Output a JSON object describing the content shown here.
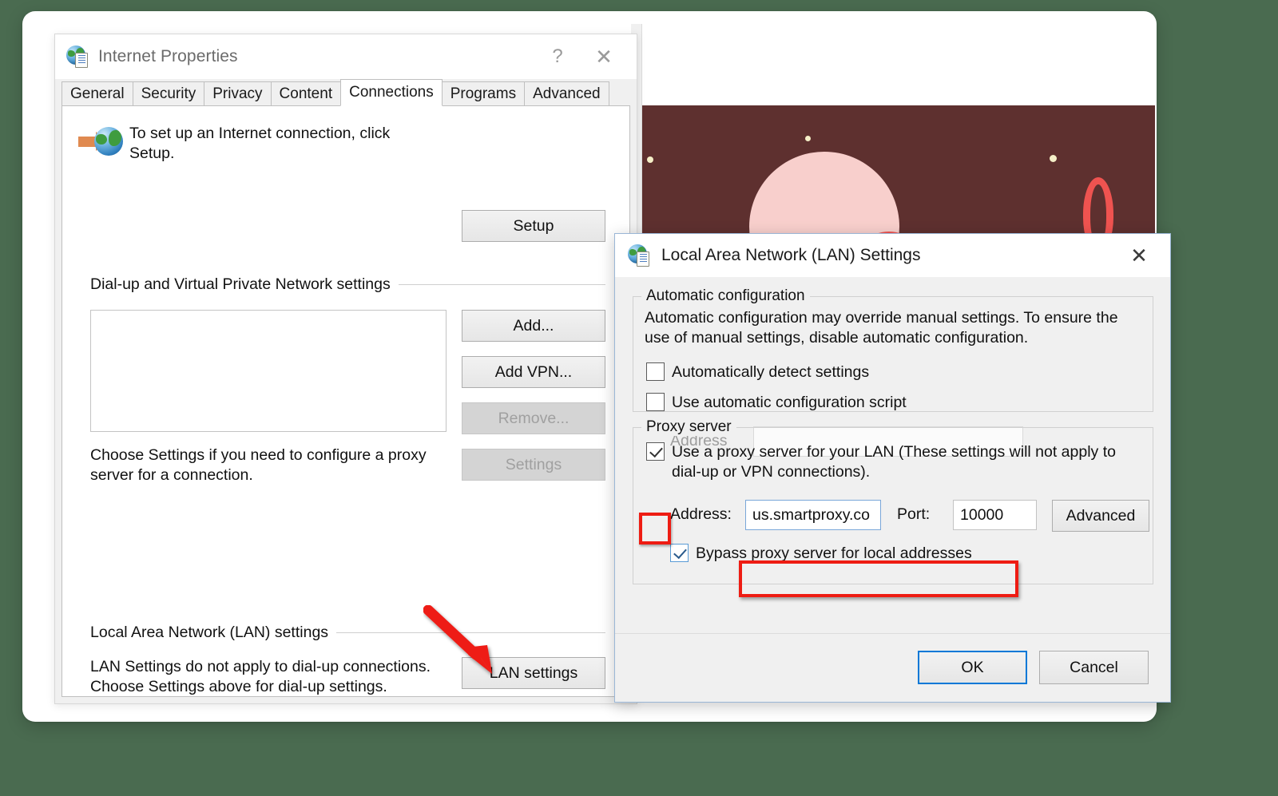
{
  "theme": {
    "page_background": "#4a6b50",
    "frame_background": "#ffffff",
    "banner_background": "#5e302f",
    "banner_accent": "#ef5350",
    "banner_circle": "#f8cfcc",
    "annotation_red": "#ee1c13",
    "default_button_border": "#0078d7"
  },
  "internet_properties": {
    "title": "Internet Properties",
    "help_glyph": "?",
    "close_glyph": "✕",
    "tabs": [
      {
        "label": "General",
        "active": false
      },
      {
        "label": "Security",
        "active": false
      },
      {
        "label": "Privacy",
        "active": false
      },
      {
        "label": "Content",
        "active": false
      },
      {
        "label": "Connections",
        "active": true
      },
      {
        "label": "Programs",
        "active": false
      },
      {
        "label": "Advanced",
        "active": false
      }
    ],
    "setup_text": "To set up an Internet connection, click Setup.",
    "setup_button": "Setup",
    "dialup_group_label": "Dial-up and Virtual Private Network settings",
    "dialup_list_value": "",
    "buttons": {
      "add": "Add...",
      "add_vpn": "Add VPN...",
      "remove": "Remove...",
      "settings": "Settings"
    },
    "choose_settings_text": "Choose Settings if you need to configure a proxy server for a connection.",
    "lan_group_label": "Local Area Network (LAN) settings",
    "lan_desc_text": "LAN Settings do not apply to dial-up connections. Choose Settings above for dial-up settings.",
    "lan_settings_button": "LAN settings"
  },
  "lan_settings": {
    "title": "Local Area Network (LAN) Settings",
    "close_glyph": "✕",
    "automatic_configuration": {
      "legend": "Automatic configuration",
      "description": "Automatic configuration may override manual settings.  To ensure the use of manual settings, disable automatic configuration.",
      "auto_detect_label": "Automatically detect settings",
      "auto_detect_checked": false,
      "use_script_label": "Use automatic configuration script",
      "use_script_checked": false,
      "address_label": "Address",
      "address_value": "",
      "address_enabled": false
    },
    "proxy_server": {
      "legend": "Proxy server",
      "use_proxy_label": "Use a proxy server for your LAN (These settings will not apply to dial-up or VPN connections).",
      "use_proxy_checked": true,
      "address_label": "Address:",
      "address_value": "us.smartproxy.co",
      "port_label": "Port:",
      "port_value": "10000",
      "advanced_button": "Advanced",
      "bypass_label": "Bypass proxy server for local addresses",
      "bypass_checked": true
    },
    "ok_button": "OK",
    "cancel_button": "Cancel"
  },
  "annotations": {
    "arrow_target": "LAN settings",
    "highlight_boxes": [
      "use-proxy-checkbox",
      "proxy-address-and-port"
    ]
  }
}
